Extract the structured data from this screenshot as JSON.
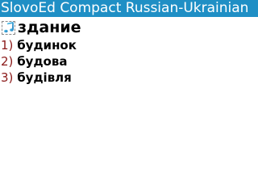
{
  "app": {
    "title": "SlovoEd Compact Russian-Ukrainian"
  },
  "entry": {
    "sound_icon": "music-note-icon",
    "headword": "здание",
    "translations": [
      {
        "number": "1)",
        "word": "будинок"
      },
      {
        "number": "2)",
        "word": "будова"
      },
      {
        "number": "3)",
        "word": "будівля"
      }
    ]
  },
  "colors": {
    "title_bar": "#1f8fc5",
    "title_text": "#ffffff",
    "number_text": "#8b1a1a",
    "word_text": "#000000",
    "background": "#ffffff"
  }
}
